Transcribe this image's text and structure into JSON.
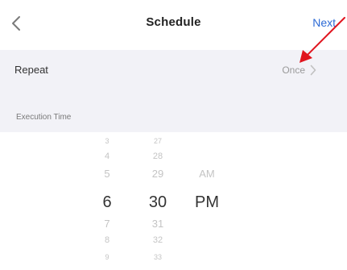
{
  "nav": {
    "title": "Schedule",
    "next_label": "Next"
  },
  "repeat": {
    "label": "Repeat",
    "value": "Once"
  },
  "section": {
    "execution_time_label": "Execution Time"
  },
  "picker": {
    "hours": [
      "3",
      "4",
      "5",
      "6",
      "7",
      "8",
      "9"
    ],
    "minutes": [
      "27",
      "28",
      "29",
      "30",
      "31",
      "32",
      "33"
    ],
    "periods": [
      "AM",
      "PM"
    ],
    "selected": {
      "hour": "6",
      "minute": "30",
      "period": "PM"
    }
  },
  "colors": {
    "accent": "#2d6bd6",
    "annotation_arrow": "#e0141e",
    "section_bg": "#f2f2f7"
  },
  "icons": {
    "back": "chevron-left-icon",
    "row_disclosure": "chevron-right-icon"
  }
}
